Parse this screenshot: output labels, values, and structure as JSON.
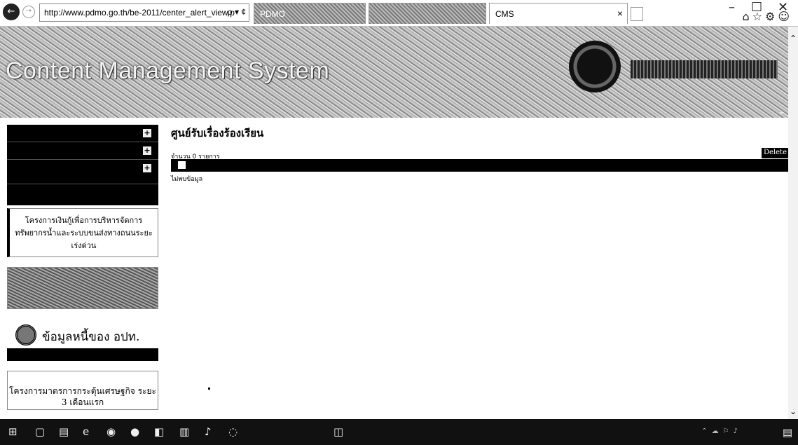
{
  "browser": {
    "address_url": "http://www.pdmo.go.th/be-2011/center_alert_view.p",
    "address_controls": "ρ ▾ ¢",
    "tabs": [
      {
        "label": "PDMO",
        "active": false
      },
      {
        "label": "",
        "active": false
      },
      {
        "label": "CMS",
        "active": true
      }
    ],
    "window_controls": {
      "minimize": "–",
      "maximize": "☐",
      "close": "✕"
    },
    "toolbar_icons": [
      "home-icon",
      "star-icon",
      "settings-icon",
      "smiley-icon"
    ]
  },
  "header": {
    "title": "Content Management System",
    "user_links": ""
  },
  "sidebar": {
    "menu": [
      {
        "label": "",
        "has_expand": true
      },
      {
        "label": "",
        "has_expand": true
      },
      {
        "label": "",
        "has_expand": true
      },
      {
        "label": "",
        "has_expand": false
      }
    ],
    "expand_symbol": "+",
    "promos": [
      {
        "label": "โครงการเงินกู้เพื่อการบริหารจัดการทรัพยากรน้ำและระบบขนส่งทางถนนระยะเร่งด่วน"
      },
      {
        "label": ""
      },
      {
        "label": "ข้อมูลหนี้ของ อปท."
      },
      {
        "label": "โครงการมาตรการกระตุ้นเศรษฐกิจ ระยะ 3 เดือนแรก"
      }
    ]
  },
  "main": {
    "title": "ศูนย์รับเรื่องร้องเรียน",
    "record_count": "จำนวน 0 รายการ",
    "delete_label": "Delete",
    "columns": [
      "",
      "",
      "",
      "",
      "",
      ""
    ],
    "empty_message": "ไม่พบข้อมูล"
  },
  "taskbar": {
    "clock_time": "",
    "clock_date": ""
  }
}
